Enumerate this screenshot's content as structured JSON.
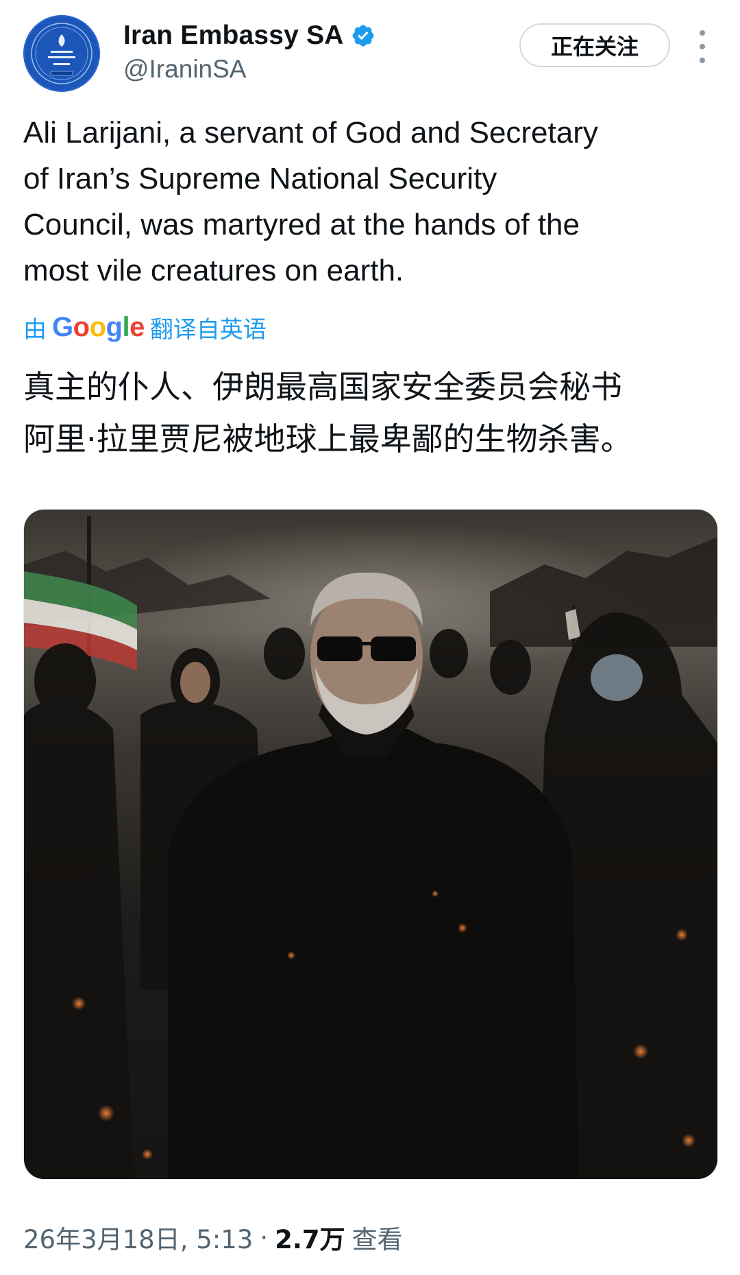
{
  "account": {
    "display_name": "Iran Embassy SA",
    "handle": "@IraninSA",
    "verified": true,
    "avatar_icon": "embassy-seal-icon",
    "avatar_color": "#1b56b8"
  },
  "header": {
    "follow_label": "正在关注",
    "more_icon": "more-vertical-icon"
  },
  "tweet": {
    "text": "Ali Larijani, a servant of God and Secretary\nof Iran’s Supreme National Security\nCouncil, was martyred at the hands of the\nmost vile creatures on earth.",
    "translated_prefix": "由",
    "translated_provider": "Google",
    "translated_suffix": "翻译自英语",
    "translation": "真主的仆人、伊朗最高国家安全委员会秘书\n阿里·拉里贾尼被地球上最卑鄙的生物杀害。",
    "media_description_icon": "photo-icon"
  },
  "meta": {
    "date_time": "26年3月18日, 5:13",
    "separator": "·",
    "views_count": "2.7万",
    "views_label": "查看"
  },
  "colors": {
    "link": "#1d9bf0",
    "verified": "#1d9bf0",
    "text": "#0f1419",
    "secondary": "#536471"
  }
}
